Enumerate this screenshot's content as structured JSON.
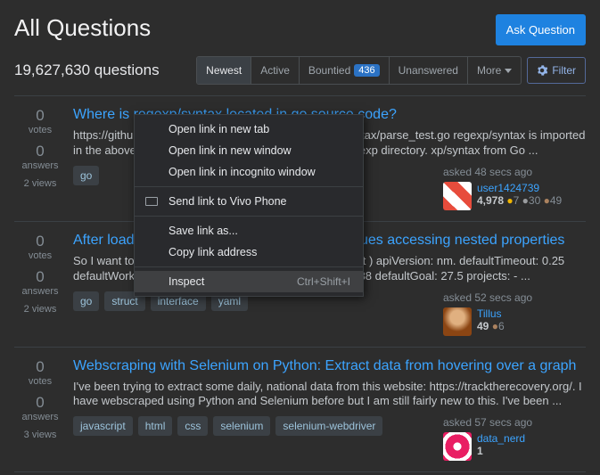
{
  "header": {
    "title": "All Questions",
    "ask_button": "Ask Question",
    "count_text": "19,627,630 questions"
  },
  "tabs": {
    "newest": "Newest",
    "active": "Active",
    "bountied": "Bountied",
    "bountied_count": "436",
    "unanswered": "Unanswered",
    "more": "More"
  },
  "filter": {
    "label": "Filter"
  },
  "questions": [
    {
      "votes": "0",
      "votes_label": "votes",
      "answers": "0",
      "answers_label": "answers",
      "views": "2 views",
      "title": "Where is regexp/syntax located in go source code?",
      "excerpt": "https://github.com/golang/go/blob/master/src/regexp/syntax/parse_test.go regexp/syntax is imported in the above go file. But there is no /syntax folder in /regexp directory. xp/syntax from Go ...",
      "tags": [
        "go"
      ],
      "asked": "asked 48 secs ago",
      "user": "user1424739",
      "rep": "4,978",
      "gold": "7",
      "silver": "30",
      "bronze": "49"
    },
    {
      "votes": "0",
      "votes_label": "votes",
      "answers": "0",
      "answers_label": "answers",
      "views": "2 views",
      "title": "After loading a yaml in golang I am having issues accessing nested properties",
      "excerpt": "So I want to load in a yaml. ( If helpful, It's ibm cdk output ) apiVersion: nm. defaultTimeout: 0.25 defaultWorkspace: ibm workspaces: ibm: client: 47943938 defaultGoal: 27.5 projects: - ...",
      "tags": [
        "go",
        "struct",
        "interface",
        "yaml"
      ],
      "asked": "asked 52 secs ago",
      "user": "Tillus",
      "rep": "49",
      "bronze": "6"
    },
    {
      "votes": "0",
      "votes_label": "votes",
      "answers": "0",
      "answers_label": "answers",
      "views": "3 views",
      "title": "Webscraping with Selenium on Python: Extract data from hovering over a graph",
      "excerpt": "I've been trying to extract some daily, national data from this website: https://tracktherecovery.org/. I have webscraped using Python and Selenium before but I am still fairly new to this. I've been ...",
      "tags": [
        "javascript",
        "html",
        "css",
        "selenium",
        "selenium-webdriver"
      ],
      "asked": "asked 57 secs ago",
      "user": "data_nerd",
      "rep": "1"
    }
  ],
  "context_menu": {
    "open_new_tab": "Open link in new tab",
    "open_new_window": "Open link in new window",
    "open_incognito": "Open link in incognito window",
    "send_to_phone": "Send link to Vivo Phone",
    "save_as": "Save link as...",
    "copy_address": "Copy link address",
    "inspect": "Inspect",
    "inspect_shortcut": "Ctrl+Shift+I"
  }
}
